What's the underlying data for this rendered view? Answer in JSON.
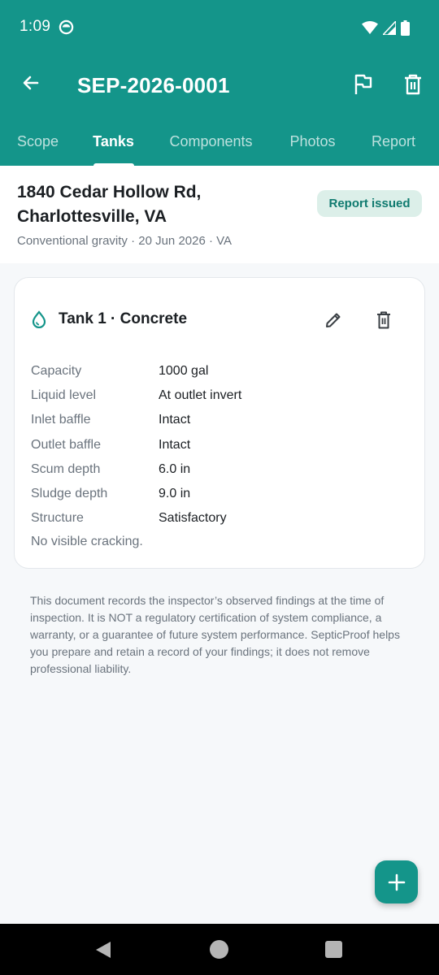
{
  "status_bar": {
    "time": "1:09"
  },
  "toolbar": {
    "title": "SEP-2026-0001",
    "back_icon": "arrow-left-icon",
    "flag_icon": "flag-icon",
    "delete_icon": "trash-icon"
  },
  "tabs": [
    {
      "label": "Scope",
      "active": false
    },
    {
      "label": "Tanks",
      "active": true
    },
    {
      "label": "Components",
      "active": false
    },
    {
      "label": "Photos",
      "active": false
    },
    {
      "label": "Report",
      "active": false
    }
  ],
  "property": {
    "address_line1": "1840 Cedar Hollow Rd,",
    "address_line2": "Charlottesville, VA",
    "meta": "Conventional gravity · 20 Jun 2026 · VA",
    "status_badge": "Report issued"
  },
  "tank_card": {
    "title": "Tank 1 · Concrete",
    "fields": [
      {
        "label": "Capacity",
        "value": "1000 gal"
      },
      {
        "label": "Liquid level",
        "value": "At outlet invert"
      },
      {
        "label": "Inlet baffle",
        "value": "Intact"
      },
      {
        "label": "Outlet baffle",
        "value": "Intact"
      },
      {
        "label": "Scum depth",
        "value": "6.0 in"
      },
      {
        "label": "Sludge depth",
        "value": "9.0 in"
      },
      {
        "label": "Structure",
        "value": "Satisfactory"
      }
    ],
    "note": "No visible cracking."
  },
  "disclaimer": "This document records the inspector’s observed findings at the time of inspection. It is NOT a regulatory certification of system compliance, a warranty, or a guarantee of future system performance. SepticProof helps you prepare and retain a record of your findings; it does not remove professional liability.",
  "colors": {
    "primary": "#14958a",
    "badge_bg": "#dcefe9",
    "badge_text": "#0f7a6f"
  }
}
